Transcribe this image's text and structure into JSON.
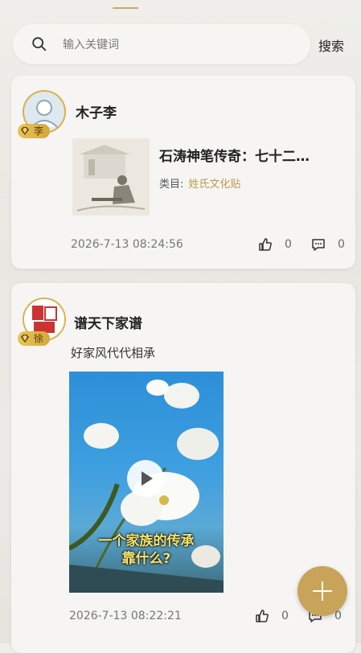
{
  "search": {
    "placeholder": "输入关键词",
    "button_label": "搜索"
  },
  "posts": [
    {
      "author": "木子李",
      "badge": "李",
      "title": "石涛神笔传奇：七十二…",
      "category_label": "类目:",
      "category_value": "姓氏文化贴",
      "timestamp": "2026-7-13 08:24:56",
      "likes": "0",
      "comments": "0"
    },
    {
      "author": "谱天下家谱",
      "badge": "徐",
      "text": "好家风代代相承",
      "video_caption_line1": "一个家族的传承",
      "video_caption_line2": "靠什么?",
      "timestamp": "2026-7-13 08:22:21",
      "likes": "0",
      "comments": "0"
    }
  ],
  "colors": {
    "accent": "#c8a35a",
    "badge": "#e0b84e",
    "category": "#c09a4a"
  },
  "icons": [
    "search-icon",
    "thumbs-up-icon",
    "comment-icon",
    "play-icon",
    "plus-icon",
    "gem-icon"
  ]
}
